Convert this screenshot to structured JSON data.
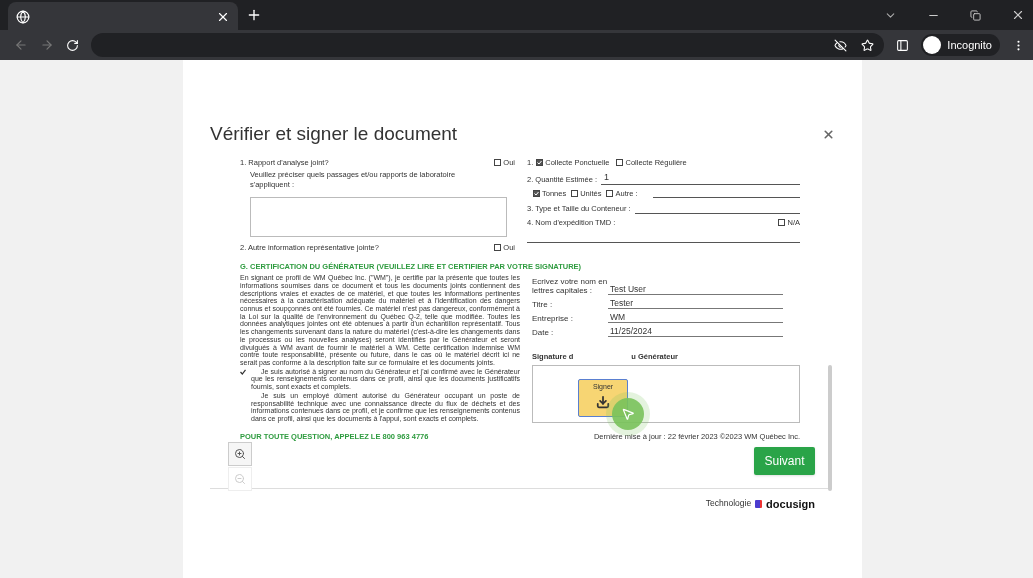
{
  "browser": {
    "profile": "Incognito"
  },
  "modal": {
    "title": "Vérifier et signer le document",
    "document": {
      "left_top": {
        "q1": {
          "label": "1. Rapport d'analyse joint?",
          "option": "Oui",
          "checked": false
        },
        "q1_prompt": "Veuillez préciser quels passages et/ou rapports de laboratoire s'appliquent :",
        "q2": {
          "label": "2. Autre information représentative jointe?",
          "option": "Oui",
          "checked": false
        }
      },
      "right_top": {
        "collection_prefix": "1.",
        "collection": [
          {
            "label": "Collecte Ponctuelle",
            "checked": true
          },
          {
            "label": "Collecte Régulière",
            "checked": false
          }
        ],
        "quantity": {
          "label": "2. Quantité Estimée :",
          "value": "1"
        },
        "units": [
          {
            "label": "Tonnes",
            "checked": true
          },
          {
            "label": "Unités",
            "checked": false
          },
          {
            "label": "Autre :",
            "checked": false
          }
        ],
        "container": "3. Type et Taille du Conteneur :",
        "shipping": {
          "label": "4. Nom d'expédition TMD :",
          "option": "N/A",
          "checked": false
        }
      },
      "section_heading": "G. CERTIFICATION DU GÉNÉRATEUR (VEUILLEZ LIRE ET CERTIFIER PAR VOTRE SIGNATURE)",
      "paragraph": "En signant ce profil de WM Québec Inc. (\"WM\"), je certifie par la présente que toutes les informations soumises dans ce document et tous les documents joints contiennent des descriptions vraies et exactes de ce matériel, et que toutes les informations pertinentes nécessaires à la caractérisation adéquate du matériel et à l'identification des dangers connus et soupçonnés ont été fournies. Ce matériel n'est pas dangereux, conformément à la Loi sur la qualité de l'environnement du Québec Q-2, telle que modifiée. Toutes les données analytiques jointes ont été obtenues à partir d'un échantillon représentatif. Tous les changements survenant dans la nature du matériel (c'est-à-dire les changements dans le processus ou les nouvelles analyses) seront identifiés par le Générateur et seront divulgués à WM avant de fournir le matériel à WM. Cette certification indemnise WM contre toute responsabilité, présente ou future, dans le cas où le matériel décrit ici ne serait pas conforme à la description faite sur ce formulaire et les documents joints.",
      "declarations": [
        {
          "checked": true,
          "text": "Je suis autorisé à signer au nom du Générateur et j'ai confirmé avec le Générateur que les renseignements contenus dans ce profil, ainsi que les documents justificatifs fournis, sont exacts et complets."
        },
        {
          "checked": false,
          "text": "Je suis un employé dûment autorisé du Générateur occupant un poste de responsabilité technique avec une connaissance directe du flux de déchets et des informations contenues dans ce profil, et je confirme que les renseignements contenus dans ce profil, ainsi que les documents à l'appui, sont exacts et complets."
        }
      ],
      "signer_fields": [
        {
          "label": "Ecrivez votre nom en lettres capitales :",
          "value": "Test User"
        },
        {
          "label": "Titre :",
          "value": "Tester"
        },
        {
          "label": "Entreprise :",
          "value": "WM"
        },
        {
          "label": "Date :",
          "value": "11/25/2024"
        }
      ],
      "signature_heading": [
        "Signature d",
        "u Générateur"
      ],
      "signer_tag": "Signer",
      "phone_line": "POUR TOUTE QUESTION, APPELEZ LE 800 963 4776",
      "updated": "Dernière mise à jour : 22 février 2023 ©2023 WM Québec Inc."
    },
    "next_button": "Suivant",
    "powered_by": {
      "label": "Technologie",
      "brand": "docusign"
    }
  }
}
